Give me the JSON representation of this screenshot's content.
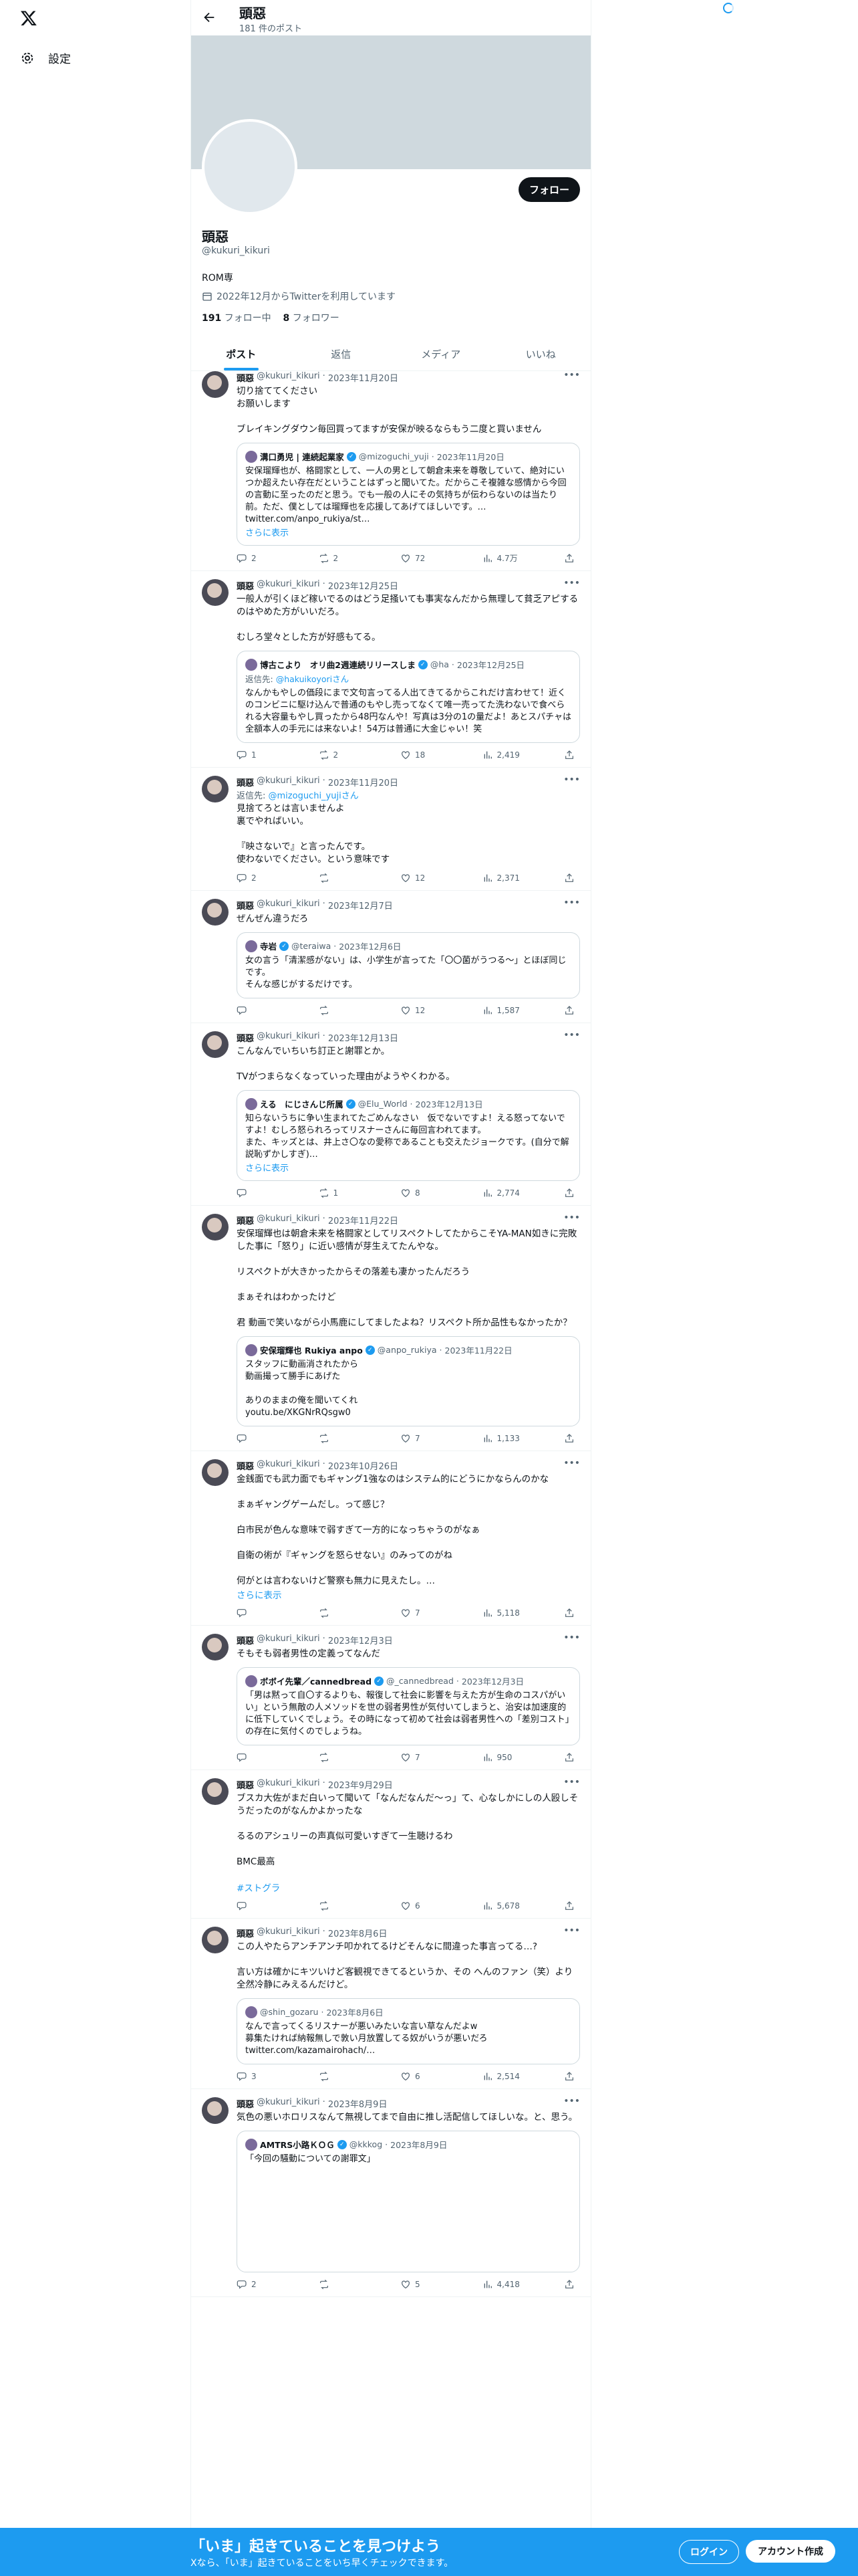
{
  "nav": {
    "settings_label": "設定",
    "settings_icon": "gear-icon",
    "logo": "x-logo-icon"
  },
  "topbar": {
    "name": "頭惡",
    "post_count": "181 件のポスト"
  },
  "profile": {
    "follow_label": "フォロー",
    "name": "頭惡",
    "handle": "@kukuri_kikuri",
    "bio": "ROM専",
    "joined": "2022年12月からTwitterを利用しています",
    "following_count": "191",
    "following_label": "フォロー中",
    "followers_count": "8",
    "followers_label": "フォロワー"
  },
  "tabs": [
    "ポスト",
    "返信",
    "メディア",
    "いいね"
  ],
  "tweets": [
    {
      "name": "頭惡",
      "handle": "@kukuri_kikuri",
      "date": "2023年11月20日",
      "reply_to": "",
      "text": "切り捨ててください\nお願いします\n\nブレイキングダウン毎回買ってますが安保が映るならもう二度と買いません",
      "tag": "",
      "show_more": "",
      "quote": {
        "name": "溝口勇児 | 連続起業家",
        "handle": "@mizoguchi_yuji",
        "date": "2023年11月20日",
        "text": "安保瑠輝也が、格闘家として、一人の男として朝倉未来を尊敬していて、絶対にいつか超えたい存在だということはずっと聞いてた。だからこそ複雑な感情から今回の言動に至ったのだと思う。でも一般の人にその気持ちが伝わらないのは当たり前。ただ、僕としては瑠輝也を応援してあげてほしいです。… twitter.com/anpo_rukiya/st…",
        "show_more": "さらに表示"
      },
      "replies": "2",
      "reposts": "2",
      "likes": "72",
      "views": "4.7万"
    },
    {
      "name": "頭惡",
      "handle": "@kukuri_kikuri",
      "date": "2023年12月25日",
      "reply_to": "",
      "text": "一般人が引くほど稼いでるのはどう足掻いても事実なんだから無理して貧乏アピするのはやめた方がいいだろ。\n\nむしろ堂々とした方が好感もてる。",
      "tag": "",
      "show_more": "",
      "quote": {
        "name": "博古こより　オリ曲2週連続リリースしま",
        "handle": "@ha",
        "date": "2023年12月25日",
        "reply_label": "返信先: ",
        "reply_handle": "@hakuikoyoriさん",
        "text": "なんかもやしの価段にまで文句言ってる人出てきてるからこれだけ言わせて！近くのコンビニに駆け込んで普通のもやし売ってなくて唯一売ってた洗わないで食べられる大容量もやし買ったから48円なんや！写真は3分の1の量だよ！あとスパチャは全額本人の手元には来ないよ！54万は普通に大金じゃい！笑",
        "show_more": ""
      },
      "replies": "1",
      "reposts": "2",
      "likes": "18",
      "views": "2,419"
    },
    {
      "name": "頭惡",
      "handle": "@kukuri_kikuri",
      "date": "2023年11月20日",
      "reply_to": "@mizoguchi_yujiさん",
      "reply_label": "返信先: ",
      "text": "見捨てろとは言いませんよ\n裏でやればいい。\n\n『映さないで』と言ったんです。\n使わないでください。という意味です",
      "tag": "",
      "show_more": "",
      "quote": null,
      "replies": "2",
      "reposts": "",
      "likes": "12",
      "views": "2,371"
    },
    {
      "name": "頭惡",
      "handle": "@kukuri_kikuri",
      "date": "2023年12月7日",
      "reply_to": "",
      "text": "ぜんぜん違うだろ",
      "tag": "",
      "show_more": "",
      "quote": {
        "name": "寺岩",
        "handle": "@teraiwa",
        "date": "2023年12月6日",
        "text": "女の言う「清潔感がない」は、小学生が言ってた「〇〇菌がうつる〜」とほぼ同じです。\nそんな感じがするだけです。",
        "show_more": ""
      },
      "replies": "",
      "reposts": "",
      "likes": "12",
      "views": "1,587"
    },
    {
      "name": "頭惡",
      "handle": "@kukuri_kikuri",
      "date": "2023年12月13日",
      "reply_to": "",
      "text": "こんなんでいちいち訂正と謝罪とか。\n\nTVがつまらなくなっていった理由がようやくわかる。",
      "tag": "",
      "show_more": "",
      "quote": {
        "name": "える　にじさんじ所属",
        "handle": "@Elu_World",
        "date": "2023年12月13日",
        "text": "知らないうちに争い生まれてたごめんなさい　仮でないですよ！える怒ってないですよ！むしろ怒られろってリスナーさんに毎回言われてます。\nまた、キッズとは、井上さ〇なの愛称であることも交えたジョークです。(自分で解説恥ずかしすぎ)…",
        "show_more": "さらに表示"
      },
      "replies": "",
      "reposts": "1",
      "likes": "8",
      "views": "2,774"
    },
    {
      "name": "頭惡",
      "handle": "@kukuri_kikuri",
      "date": "2023年11月22日",
      "reply_to": "",
      "text": "安保瑠輝也は朝倉未来を格闘家としてリスペクトしてたからこそYA-MAN如きに完敗した事に「怒り」に近い感情が芽生えてたんやな。\n\nリスペクトが大きかったからその落差も凄かったんだろう\n\nまぁそれはわかったけど\n\n君 動画で笑いながら小馬鹿にしてましたよね？リスペクト所か品性もなかったか？",
      "tag": "",
      "show_more": "",
      "quote": {
        "name": "安保瑠輝也 Rukiya anpo",
        "handle": "@anpo_rukiya",
        "date": "2023年11月22日",
        "text": "スタッフに動画消されたから\n動画撮って勝手にあげた\n\nありのままの俺を聞いてくれ\nyoutu.be/XKGNrRQsgw0",
        "show_more": ""
      },
      "replies": "",
      "reposts": "",
      "likes": "7",
      "views": "1,133"
    },
    {
      "name": "頭惡",
      "handle": "@kukuri_kikuri",
      "date": "2023年10月26日",
      "reply_to": "",
      "text": "金銭面でも武力面でもギャング1強なのはシステム的にどうにかならんのかな\n\nまぁギャングゲームだし。って感じ？\n\n白市民が色んな意味で弱すぎて一方的になっちゃうのがなぁ\n\n自衛の術が『ギャングを怒らせない』のみってのがね\n\n何がとは言わないけど警察も無力に見えたし。…",
      "tag": "",
      "show_more": "さらに表示",
      "quote": null,
      "replies": "",
      "reposts": "",
      "likes": "7",
      "views": "5,118"
    },
    {
      "name": "頭惡",
      "handle": "@kukuri_kikuri",
      "date": "2023年12月3日",
      "reply_to": "",
      "text": "そもそも弱者男性の定義ってなんだ",
      "tag": "",
      "show_more": "",
      "quote": {
        "name": "ボボイ先輩／cannedbread",
        "handle": "@_cannedbread",
        "date": "2023年12月3日",
        "text": "「男は黙って自〇するよりも、報復して社会に影響を与えた方が生命のコスパがいい」という無敵の人メソッドを世の弱者男性が気付いてしまうと、治安は加速度的に低下していくでしょう。その時になって初めて社会は弱者男性への「差別コスト」の存在に気付くのでしょうね。",
        "show_more": ""
      },
      "replies": "",
      "reposts": "",
      "likes": "7",
      "views": "950"
    },
    {
      "name": "頭惡",
      "handle": "@kukuri_kikuri",
      "date": "2023年9月29日",
      "reply_to": "",
      "text": "ブスカ大佐がまだ白いって聞いて「なんだなんだ〜っ」て、心なしかにしの人殴しそうだったのがなんかよかったな\n\nるるのアシュリーの声真似可愛いすぎて一生聴けるわ\n\nBMC最高",
      "tag": "#ストグラ",
      "show_more": "",
      "quote": null,
      "replies": "",
      "reposts": "",
      "likes": "6",
      "views": "5,678"
    },
    {
      "name": "頭惡",
      "handle": "@kukuri_kikuri",
      "date": "2023年8月6日",
      "reply_to": "",
      "text": "この人やたらアンチアンチ叩かれてるけどそんなに間違った事言ってる…?\n\n言い方は確かにキツいけど客観視できてるというか、その へんのファン（笑）より全然冷静にみえるんだけど。",
      "tag": "",
      "show_more": "",
      "quote": {
        "name": "",
        "handle": "@shin_gozaru",
        "date": "2023年8月6日",
        "text": "なんで言ってくるリスナーが悪いみたいな言い草なんだよw\n募集たければ納報無しで敦い月放置してる奴がいうが悪いだろ\ntwitter.com/kazamairohach/…",
        "show_more": ""
      },
      "replies": "3",
      "reposts": "",
      "likes": "6",
      "views": "2,514"
    },
    {
      "name": "頭惡",
      "handle": "@kukuri_kikuri",
      "date": "2023年8月9日",
      "reply_to": "",
      "text": "気色の悪いホロリスなんて無視してまで自由に推し活配信してほしいな。と、思う。",
      "tag": "",
      "show_more": "",
      "quote": {
        "name": "AMTRS小路ＫＯＧ",
        "handle": "@kkkog",
        "date": "2023年8月9日",
        "text": "「今回の騒動についての謝罪文」",
        "show_more": "",
        "tall": true
      },
      "replies": "2",
      "reposts": "",
      "likes": "5",
      "views": "4,418"
    }
  ],
  "bottom_bar": {
    "title": "「いま」起きていることを見つけよう",
    "subtitle": "Xなら、「いま」起きていることをいち早くチェックできます。",
    "login_label": "ログイン",
    "signup_label": "アカウント作成"
  },
  "colors": {
    "accent": "#1d9bf0",
    "text": "#0f1419",
    "muted": "#536471",
    "border": "#eff3f4"
  }
}
